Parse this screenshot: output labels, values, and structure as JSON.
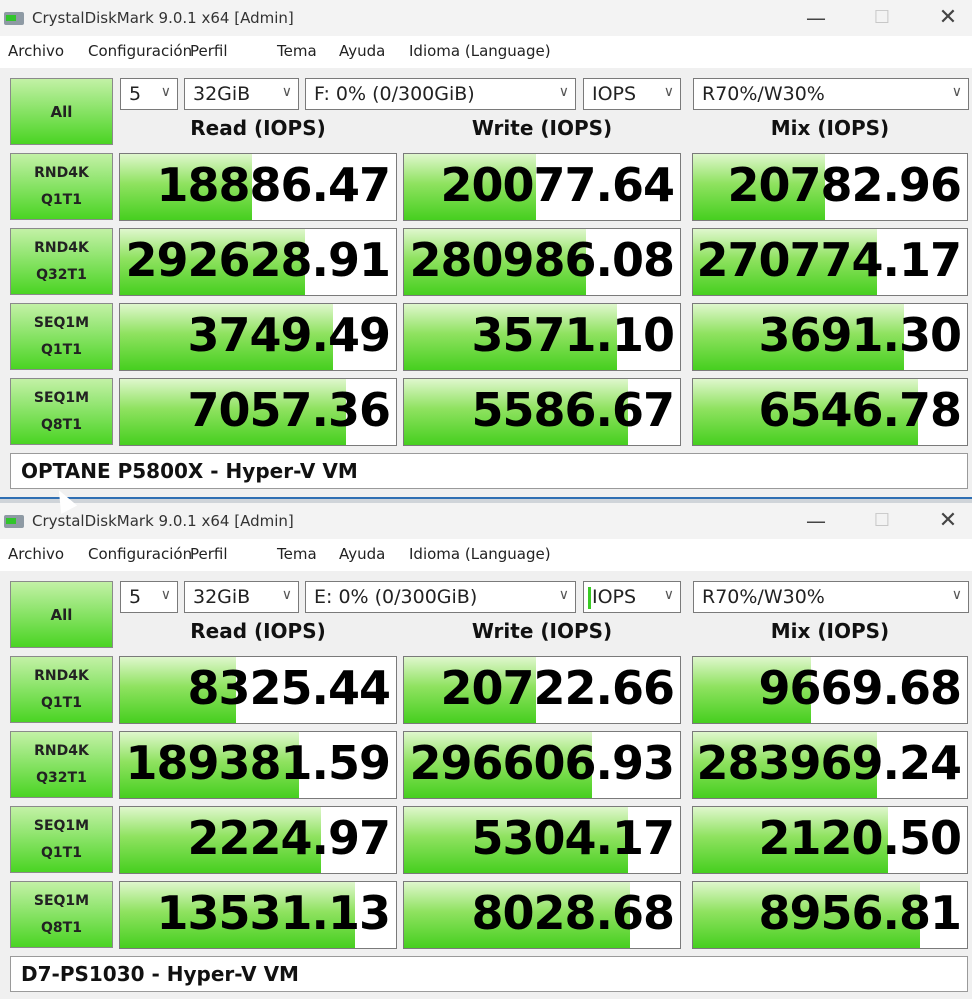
{
  "accent_green": "#46cf1f",
  "windows": [
    {
      "title": "CrystalDiskMark 9.0.1 x64 [Admin]",
      "menu": [
        "Archivo",
        "Configuración",
        "Perfil",
        "Tema",
        "Ayuda",
        "Idioma (Language)"
      ],
      "all_label": "All",
      "count": "5",
      "size": "32GiB",
      "drive": "F: 0% (0/300GiB)",
      "unit": "IOPS",
      "mix": "R70%/W30%",
      "headers": [
        "Read (IOPS)",
        "Write (IOPS)",
        "Mix (IOPS)"
      ],
      "rows": [
        {
          "l1": "RND4K",
          "l2": "Q1T1",
          "read": "18886.47",
          "write": "20077.64",
          "mixv": "20782.96",
          "fr": 0.48,
          "fw": 0.48,
          "fm": 0.48
        },
        {
          "l1": "RND4K",
          "l2": "Q32T1",
          "read": "292628.91",
          "write": "280986.08",
          "mixv": "270774.17",
          "fr": 0.67,
          "fw": 0.66,
          "fm": 0.67
        },
        {
          "l1": "SEQ1M",
          "l2": "Q1T1",
          "read": "3749.49",
          "write": "3571.10",
          "mixv": "3691.30",
          "fr": 0.77,
          "fw": 0.77,
          "fm": 0.77
        },
        {
          "l1": "SEQ1M",
          "l2": "Q8T1",
          "read": "7057.36",
          "write": "5586.67",
          "mixv": "6546.78",
          "fr": 0.82,
          "fw": 0.81,
          "fm": 0.82
        }
      ],
      "comment": "OPTANE P5800X - Hyper-V VM"
    },
    {
      "title": "CrystalDiskMark 9.0.1 x64 [Admin]",
      "menu": [
        "Archivo",
        "Configuración",
        "Perfil",
        "Tema",
        "Ayuda",
        "Idioma (Language)"
      ],
      "all_label": "All",
      "count": "5",
      "size": "32GiB",
      "drive": "E: 0% (0/300GiB)",
      "unit": "IOPS",
      "mix": "R70%/W30%",
      "headers": [
        "Read (IOPS)",
        "Write (IOPS)",
        "Mix (IOPS)"
      ],
      "rows": [
        {
          "l1": "RND4K",
          "l2": "Q1T1",
          "read": "8325.44",
          "write": "20722.66",
          "mixv": "9669.68",
          "fr": 0.42,
          "fw": 0.48,
          "fm": 0.43
        },
        {
          "l1": "RND4K",
          "l2": "Q32T1",
          "read": "189381.59",
          "write": "296606.93",
          "mixv": "283969.24",
          "fr": 0.65,
          "fw": 0.68,
          "fm": 0.67
        },
        {
          "l1": "SEQ1M",
          "l2": "Q1T1",
          "read": "2224.97",
          "write": "5304.17",
          "mixv": "2120.50",
          "fr": 0.73,
          "fw": 0.81,
          "fm": 0.71
        },
        {
          "l1": "SEQ1M",
          "l2": "Q8T1",
          "read": "13531.13",
          "write": "8028.68",
          "mixv": "8956.81",
          "fr": 0.85,
          "fw": 0.82,
          "fm": 0.83
        }
      ],
      "comment": "D7-PS1030 - Hyper-V VM"
    }
  ]
}
